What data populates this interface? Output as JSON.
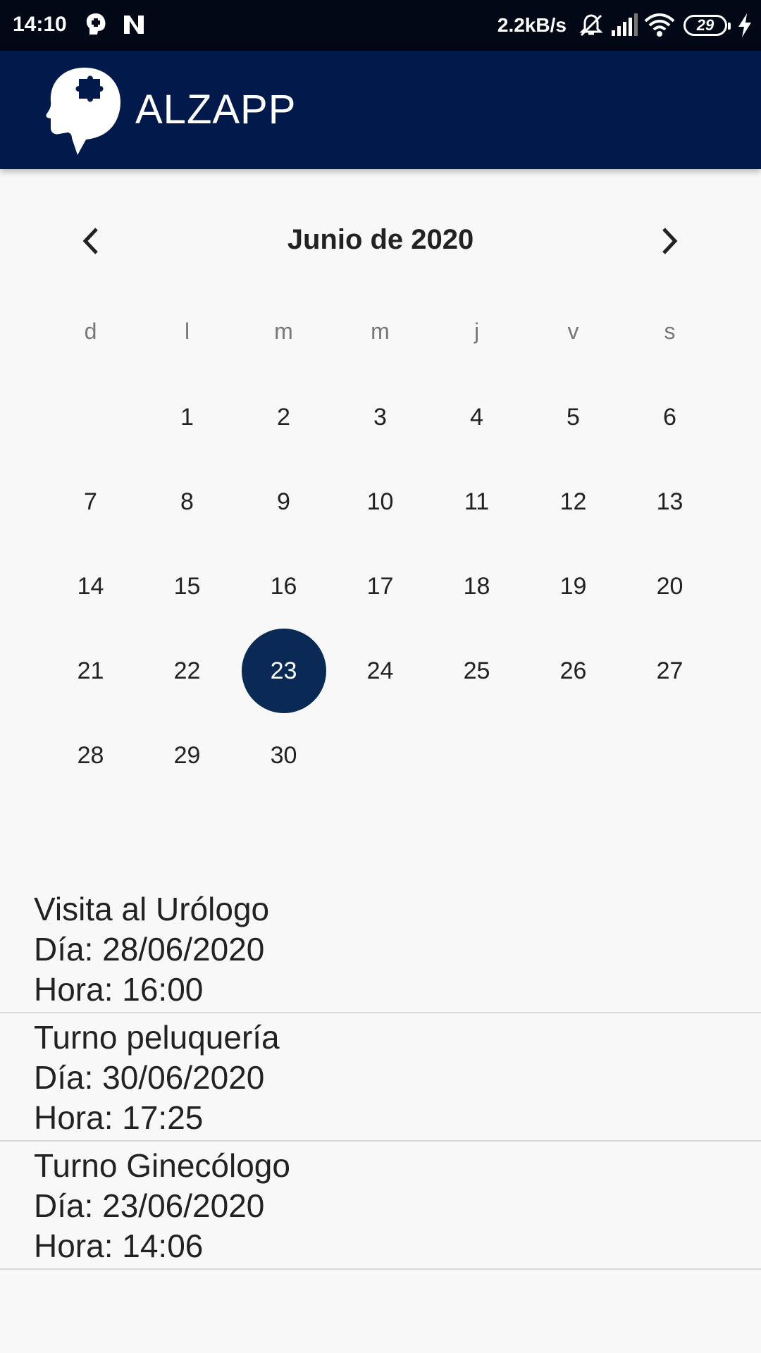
{
  "status_bar": {
    "time": "14:10",
    "network_speed": "2.2kB/s",
    "battery": "29",
    "icons": [
      "brain-notification-icon",
      "n-app-icon",
      "mute-icon",
      "signal-icon",
      "wifi-icon",
      "battery-icon",
      "charging-icon"
    ]
  },
  "app_bar": {
    "title": "ALZAPP",
    "logo_icon": "head-puzzle-icon",
    "background": "#021a4b"
  },
  "calendar": {
    "month_label": "Junio de 2020",
    "prev_icon": "chevron-left-icon",
    "next_icon": "chevron-right-icon",
    "weekdays": [
      "d",
      "l",
      "m",
      "m",
      "j",
      "v",
      "s"
    ],
    "days": [
      "",
      "1",
      "2",
      "3",
      "4",
      "5",
      "6",
      "7",
      "8",
      "9",
      "10",
      "11",
      "12",
      "13",
      "14",
      "15",
      "16",
      "17",
      "18",
      "19",
      "20",
      "21",
      "22",
      "23",
      "24",
      "25",
      "26",
      "27",
      "28",
      "29",
      "30"
    ],
    "selected_day": "23",
    "selected_color": "#0a2a55"
  },
  "events": [
    {
      "title": "Visita al Urólogo",
      "date": "Día: 28/06/2020",
      "time": "Hora: 16:00"
    },
    {
      "title": "Turno peluquería",
      "date": "Día: 30/06/2020",
      "time": "Hora: 17:25"
    },
    {
      "title": "Turno Ginecólogo",
      "date": "Día: 23/06/2020",
      "time": "Hora: 14:06"
    }
  ]
}
